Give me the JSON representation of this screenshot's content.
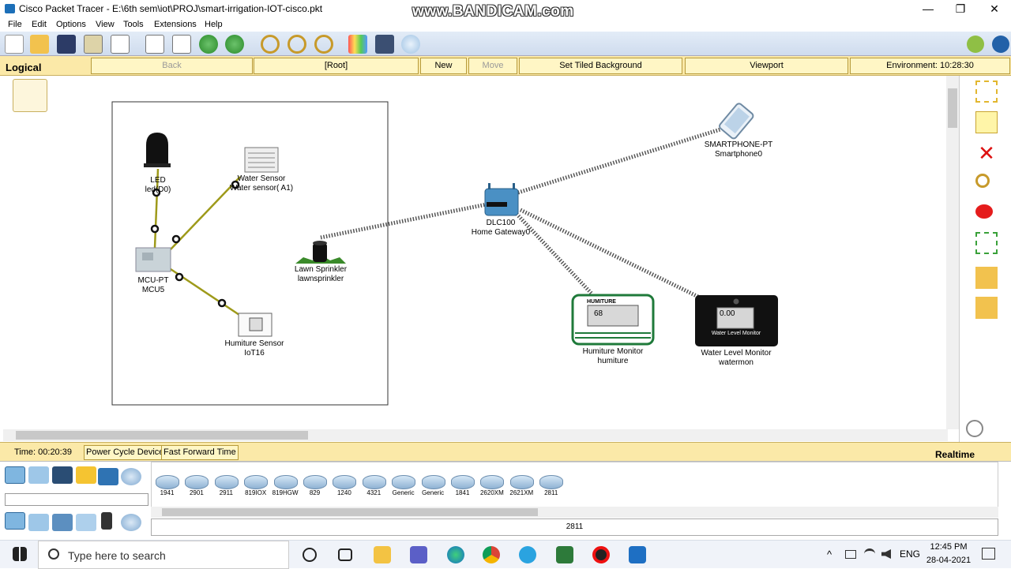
{
  "titlebar": {
    "title": "Cisco Packet Tracer - E:\\6th sem\\iot\\PROJ\\smart-irrigation-IOT-cisco.pkt",
    "minimize": "—",
    "restore": "❐",
    "close": "✕"
  },
  "watermark": "www.BANDICAM.com",
  "menu": {
    "file": "File",
    "edit": "Edit",
    "options": "Options",
    "view": "View",
    "tools": "Tools",
    "extensions": "Extensions",
    "help": "Help"
  },
  "logical": {
    "label": "Logical",
    "back": "Back",
    "root": "[Root]",
    "new_cluster": "New Cluster",
    "move_object": "Move Object",
    "set_tiled_background": "Set Tiled Background",
    "viewport": "Viewport",
    "environment": "Environment: 10:28:30"
  },
  "devices": {
    "led": {
      "type": "LED",
      "name": "led(D0)"
    },
    "water_sensor": {
      "type": "Water Sensor",
      "name": "Water sensor( A1)"
    },
    "mcu": {
      "type": "MCU-PT",
      "name": "MCU5"
    },
    "humiture_sensor": {
      "type": "Humiture Sensor",
      "name": "IoT16"
    },
    "sprinkler": {
      "type": "Lawn Sprinkler",
      "name": "lawnsprinkler"
    },
    "gateway": {
      "type": "DLC100",
      "name": "Home Gateway0"
    },
    "smartphone": {
      "type": "SMARTPHONE-PT",
      "name": "Smartphone0"
    },
    "humiture_monitor": {
      "type": "Humiture Monitor",
      "name": "humiture",
      "header": "HUMITURE",
      "value": "68"
    },
    "water_monitor": {
      "type": "Water Level Monitor",
      "name": "watermon",
      "value": "0.00",
      "caption": "Water Level Monitor"
    }
  },
  "status": {
    "time": "Time: 00:20:39",
    "power_cycle": "Power Cycle Devices",
    "fast_forward": "Fast Forward Time",
    "mode": "Realtime"
  },
  "device_list": {
    "items": [
      "1941",
      "2901",
      "2911",
      "819IOX",
      "819HGW",
      "829",
      "1240",
      "4321",
      "Generic",
      "Generic",
      "1841",
      "2620XM",
      "2621XM",
      "2811"
    ],
    "selected": "2811"
  },
  "taskbar": {
    "search_placeholder": "Type here to search",
    "lang": "ENG",
    "time": "12:45 PM",
    "date": "28-04-2021"
  },
  "colors": {
    "logical_bar": "#fbe9a8",
    "cable": "#9e9a1a",
    "toolbar": "#d6e2f1"
  }
}
